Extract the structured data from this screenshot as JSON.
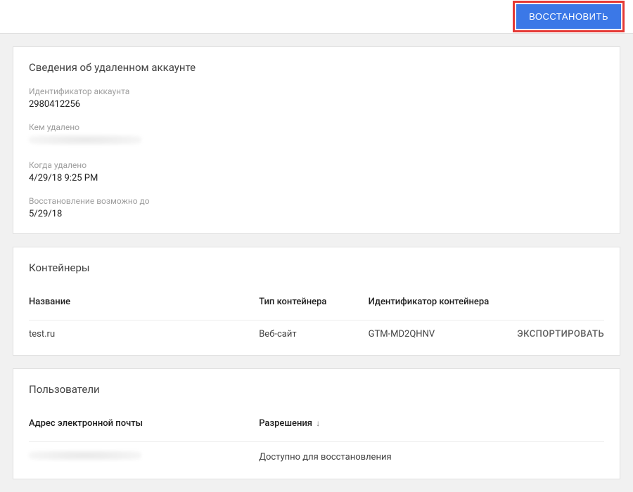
{
  "header": {
    "restore_label": "ВОССТАНОВИТЬ"
  },
  "account_card": {
    "title": "Сведения об удаленном аккаунте",
    "fields": {
      "id_label": "Идентификатор аккаунта",
      "id_value": "2980412256",
      "deleted_by_label": "Кем удалено",
      "deleted_at_label": "Когда удалено",
      "deleted_at_value": "4/29/18 9:25 PM",
      "recover_until_label": "Восстановление возможно до",
      "recover_until_value": "5/29/18"
    }
  },
  "containers_card": {
    "title": "Контейнеры",
    "headers": {
      "name": "Название",
      "type": "Тип контейнера",
      "id": "Идентификатор контейнера"
    },
    "rows": [
      {
        "name": "test.ru",
        "type": "Веб-сайт",
        "id": "GTM-MD2QHNV",
        "export": "ЭКСПОРТИРОВАТЬ"
      }
    ]
  },
  "users_card": {
    "title": "Пользователи",
    "headers": {
      "email": "Адрес электронной почты",
      "permissions": "Разрешения"
    },
    "rows": [
      {
        "permission": "Доступно для восстановления"
      }
    ]
  }
}
